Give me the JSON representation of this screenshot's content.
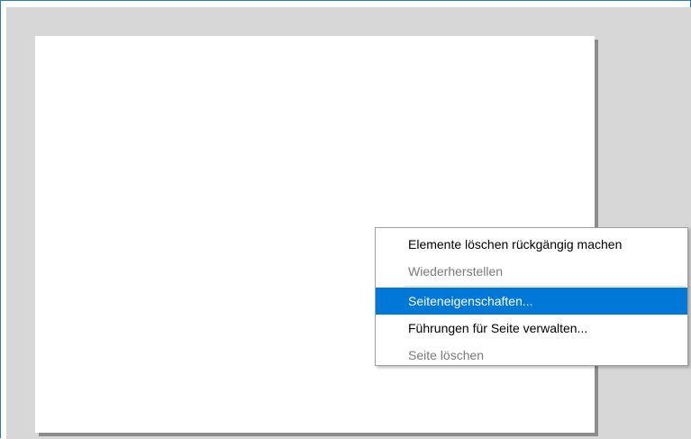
{
  "context_menu": {
    "items": [
      {
        "label": "Elemente löschen rückgängig machen",
        "enabled": true,
        "highlighted": false
      },
      {
        "label": "Wiederherstellen",
        "enabled": false,
        "highlighted": false
      },
      {
        "label": "Seiteneigenschaften...",
        "enabled": true,
        "highlighted": true
      },
      {
        "label": "Führungen für Seite verwalten...",
        "enabled": true,
        "highlighted": false
      },
      {
        "label": "Seite löschen",
        "enabled": false,
        "highlighted": false
      }
    ]
  },
  "colors": {
    "window_border": "#2b78c5",
    "workspace_bg": "#d7d7d7",
    "page_bg": "#ffffff",
    "highlight": "#0078d7",
    "disabled_text": "#7a7a7a"
  }
}
